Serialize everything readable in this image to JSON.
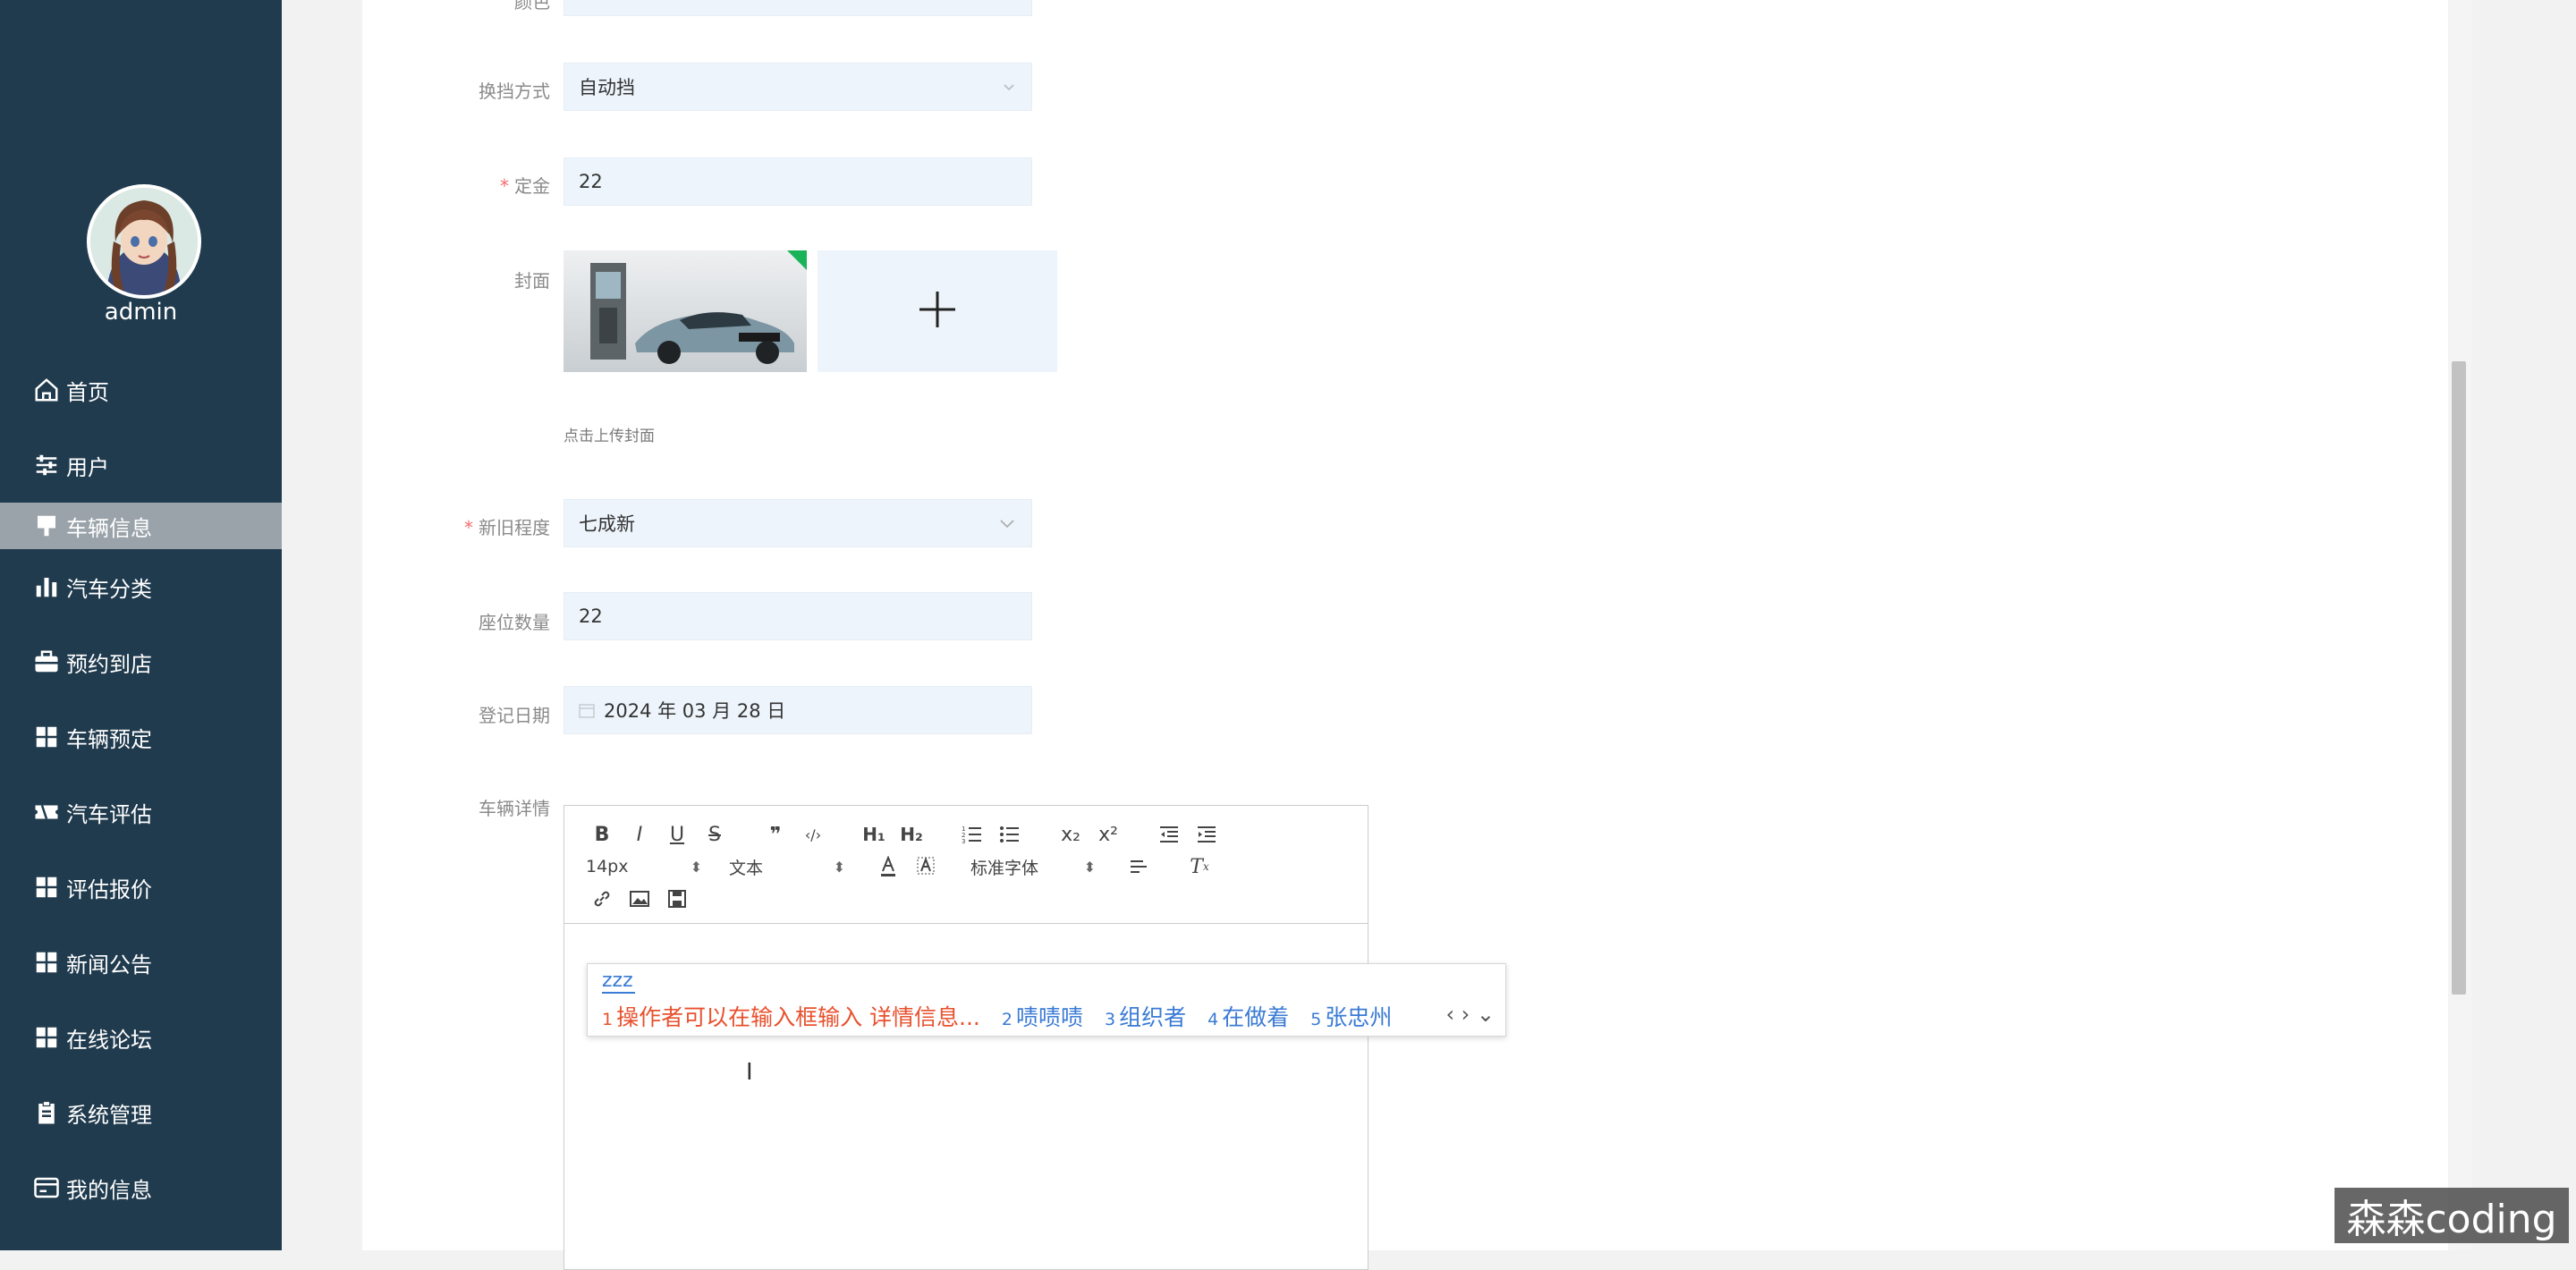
{
  "sidebar": {
    "username": "admin",
    "items": [
      {
        "label": "首页",
        "icon": "home-icon"
      },
      {
        "label": "用户",
        "icon": "sliders-icon"
      },
      {
        "label": "车辆信息",
        "icon": "stamp-icon",
        "active": true
      },
      {
        "label": "汽车分类",
        "icon": "bar-chart-icon"
      },
      {
        "label": "预约到店",
        "icon": "briefcase-icon"
      },
      {
        "label": "车辆预定",
        "icon": "grid-icon"
      },
      {
        "label": "汽车评估",
        "icon": "ticket-icon"
      },
      {
        "label": "评估报价",
        "icon": "grid-icon"
      },
      {
        "label": "新闻公告",
        "icon": "grid-icon"
      },
      {
        "label": "在线论坛",
        "icon": "grid-icon"
      },
      {
        "label": "系统管理",
        "icon": "clipboard-icon"
      },
      {
        "label": "我的信息",
        "icon": "card-icon"
      }
    ]
  },
  "form": {
    "top_label": "颜色",
    "gear": {
      "label": "换挡方式",
      "value": "自动挡"
    },
    "deposit": {
      "label": "定金",
      "value": "22"
    },
    "cover": {
      "label": "封面",
      "hint": "点击上传封面"
    },
    "condition": {
      "label": "新旧程度",
      "value": "七成新"
    },
    "seats": {
      "label": "座位数量",
      "value": "22"
    },
    "reg_date": {
      "label": "登记日期",
      "value": "2024 年 03 月 28 日"
    },
    "details": {
      "label": "车辆详情"
    }
  },
  "editor": {
    "font_size": "14px",
    "block_type": "文本",
    "font_family": "标准字体",
    "buttons": [
      "B",
      "I",
      "U",
      "S",
      "❞",
      "‹/›",
      "H₁",
      "H₂",
      "ordered-list",
      "bullet-list",
      "x₂",
      "x²",
      "outdent",
      "indent"
    ]
  },
  "ime": {
    "input": "zzz",
    "candidates": [
      {
        "n": "1",
        "text": "操作者可以在输入框输入 详情信息..."
      },
      {
        "n": "2",
        "text": "啧啧啧"
      },
      {
        "n": "3",
        "text": "组织者"
      },
      {
        "n": "4",
        "text": "在做着"
      },
      {
        "n": "5",
        "text": "张忠州"
      }
    ],
    "nav": "‹ › ⌄"
  },
  "watermark": "森森coding",
  "colors": {
    "sidebar_bg": "#203b4e",
    "active_item_bg": "#9aa3aa",
    "field_bg": "#edf4fb",
    "required": "#f56c6c",
    "ime_highlight": "#e8512e",
    "ime_candidate": "#3a7bd5"
  }
}
